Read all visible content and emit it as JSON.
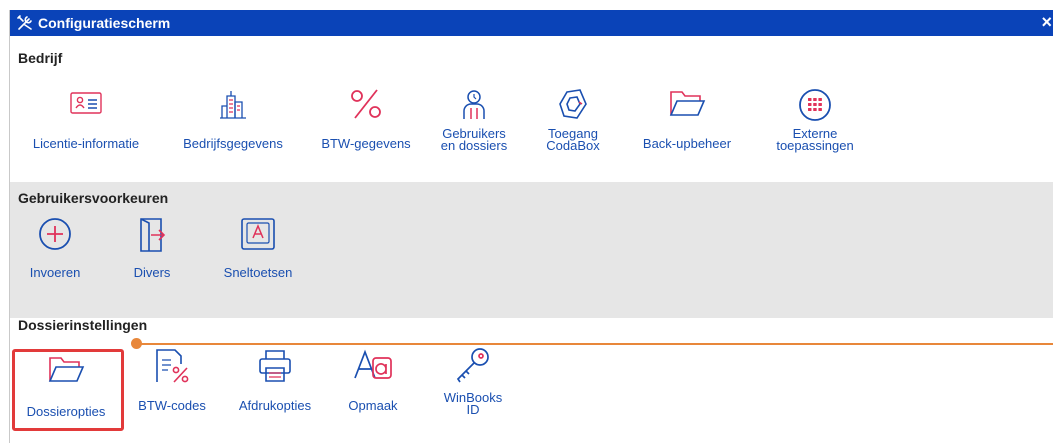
{
  "window": {
    "title": "Configuratiescherm",
    "close_label": "×"
  },
  "sections": {
    "bedrijf": {
      "title": "Bedrijf",
      "items": [
        {
          "label": "Licentie-informatie"
        },
        {
          "label": "Bedrijfsgegevens"
        },
        {
          "label": "BTW-gegevens"
        },
        {
          "label_line1": "Gebruikers",
          "label_line2": "en dossiers"
        },
        {
          "label_line1": "Toegang",
          "label_line2": "CodaBox"
        },
        {
          "label": "Back-upbeheer"
        },
        {
          "label_line1": "Externe",
          "label_line2": "toepassingen"
        }
      ]
    },
    "gebruikersvoorkeuren": {
      "title": "Gebruikersvoorkeuren",
      "items": [
        {
          "label": "Invoeren"
        },
        {
          "label": "Divers"
        },
        {
          "label": "Sneltoetsen"
        }
      ]
    },
    "dossierinstellingen": {
      "title": "Dossierinstellingen",
      "items": [
        {
          "label": "Dossieropties"
        },
        {
          "label": "BTW-codes"
        },
        {
          "label": "Afdrukopties"
        },
        {
          "label": "Opmaak"
        },
        {
          "label_line1": "WinBooks",
          "label_line2": "ID"
        }
      ]
    }
  },
  "colors": {
    "title_bar": "#0a43b8",
    "link_blue": "#1a4fb0",
    "icon_red": "#e0325a",
    "section_grey": "#e6e6e6",
    "annotation_orange": "#e8873a",
    "highlight_red": "#e23a3a"
  },
  "icons": [
    "tools-icon",
    "id-card-icon",
    "building-icon",
    "percent-icon",
    "user-icon",
    "codabox-icon",
    "folder-icon",
    "keypad-icon",
    "plus-circle-icon",
    "door-arrow-icon",
    "keyboard-key-icon",
    "document-percent-icon",
    "printer-icon",
    "text-style-icon",
    "key-icon"
  ]
}
